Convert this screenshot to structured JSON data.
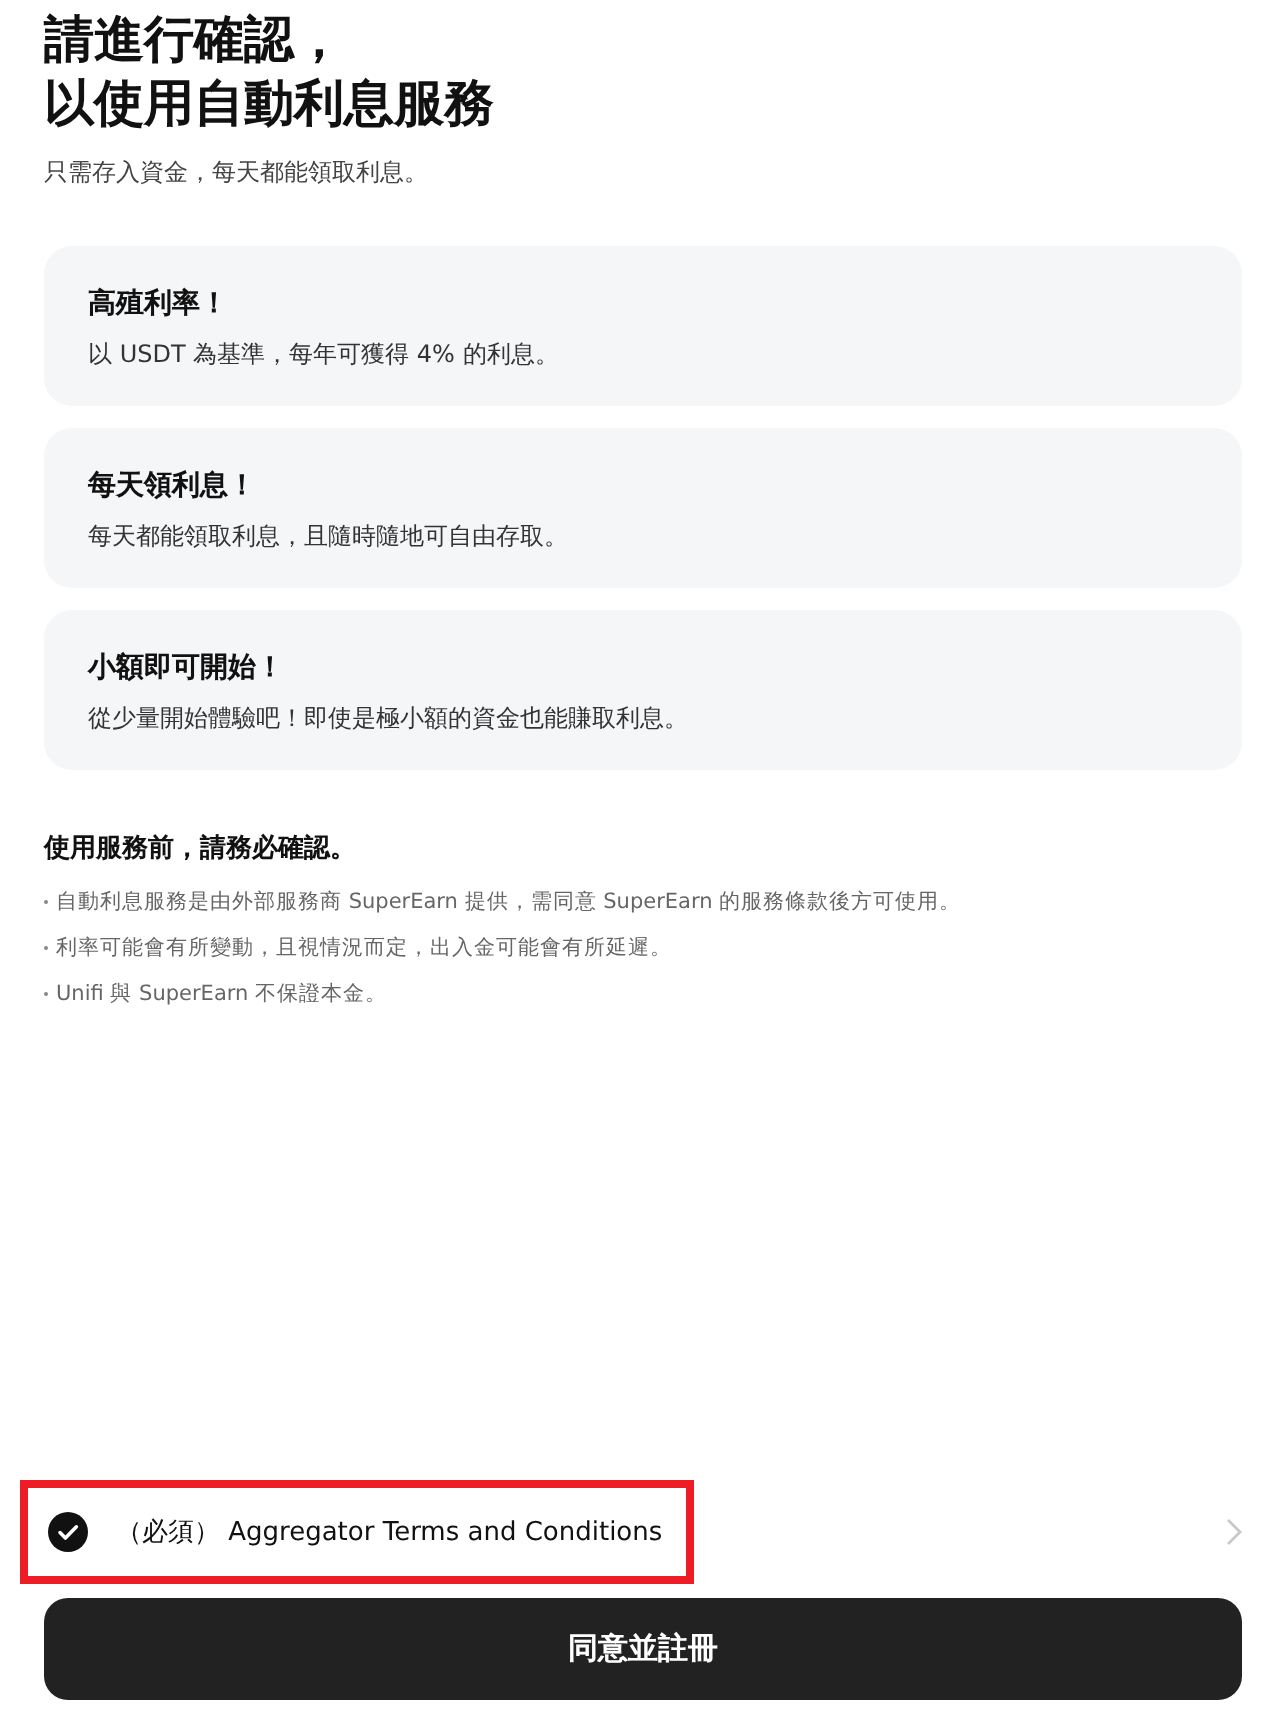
{
  "title_lines": [
    "請進行確認，",
    "以使用自動利息服務"
  ],
  "subtitle": "只需存入資金，每天都能領取利息。",
  "features": [
    {
      "title": "高殖利率！",
      "description": "以 USDT 為基準，每年可獲得 4% 的利息。"
    },
    {
      "title": "每天領利息！",
      "description": "每天都能領取利息，且隨時隨地可自由存取。"
    },
    {
      "title": "小額即可開始！",
      "description": "從少量開始體驗吧！即使是極小額的資金也能賺取利息。"
    }
  ],
  "notice": {
    "heading": "使用服務前，請務必確認。",
    "items": [
      "自動利息服務是由外部服務商 SuperEarn 提供，需同意 SuperEarn 的服務條款後方可使用。",
      "利率可能會有所變動，且視情況而定，出入金可能會有所延遲。",
      "Unifi 與 SuperEarn 不保證本金。"
    ]
  },
  "agreement": {
    "label": "（必須） Aggregator Terms and Conditions",
    "checked": true,
    "highlighted": true
  },
  "submit_button": "同意並註冊"
}
